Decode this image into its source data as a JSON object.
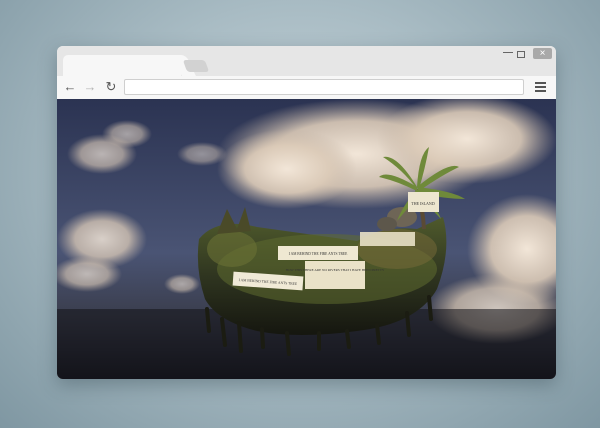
{
  "browser": {
    "tab_title": "",
    "address_value": "",
    "window_close_glyph": "×",
    "nav": {
      "back": "←",
      "forward": "→",
      "reload": "↻"
    }
  },
  "content": {
    "scene": "floating island with palm tree and paper notes",
    "signs": [
      {
        "text": "I AM BEHIND THE FIRE ANTS TREE"
      },
      {
        "text": "THE ISLAND"
      },
      {
        "text": "HOW THIS THERE ARE NO RIVERS THAT I HAVE BEEN PRETTY"
      },
      {
        "text": "I AM BEHIND THE FIRE ANTS TREE"
      }
    ]
  },
  "colors": {
    "background": "#a9bcc4",
    "frame": "#e6e6e6",
    "toolbar": "#f7f7f7",
    "sky_top": "#2d3550",
    "sky_bottom": "#1a1c26"
  }
}
